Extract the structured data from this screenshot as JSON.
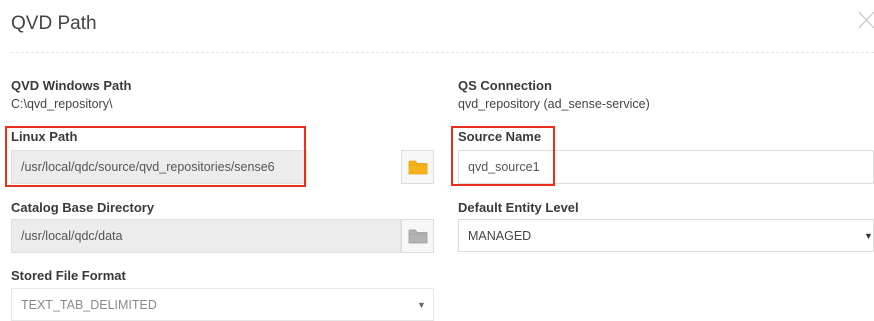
{
  "dialog": {
    "title": "QVD Path"
  },
  "fields": {
    "qvd_windows_path": {
      "label": "QVD Windows Path",
      "value": "C:\\qvd_repository\\"
    },
    "qs_connection": {
      "label": "QS Connection",
      "value": "qvd_repository (ad_sense-service)"
    },
    "linux_path": {
      "label": "Linux Path",
      "value": "/usr/local/qdc/source/qvd_repositories/sense6"
    },
    "source_name": {
      "label": "Source Name",
      "value": "qvd_source1"
    },
    "catalog_base_directory": {
      "label": "Catalog Base Directory",
      "value": "/usr/local/qdc/data"
    },
    "default_entity_level": {
      "label": "Default Entity Level",
      "selected": "MANAGED"
    },
    "stored_file_format": {
      "label": "Stored File Format",
      "selected": "TEXT_TAB_DELIMITED"
    }
  },
  "icons": {
    "close": "close-icon",
    "linux_path_browse": "folder-icon",
    "catalog_browse": "folder-icon",
    "dropdown": "caret-down-icon"
  },
  "colors": {
    "highlight": "#e8301c",
    "folder_active": "#f5b31a",
    "folder_inactive": "#a9a9a9",
    "disabled_field_bg": "#ececec"
  }
}
